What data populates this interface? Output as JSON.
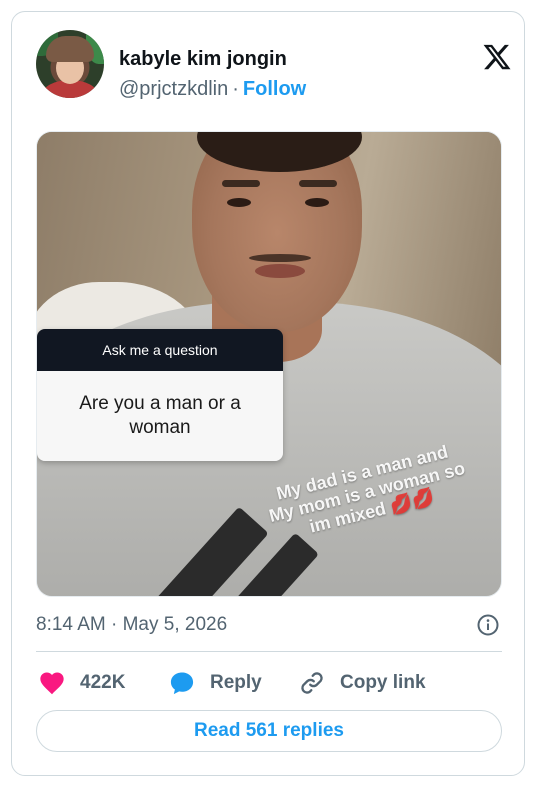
{
  "author": {
    "name": "kabyle kim jongin",
    "handle": "@prjctzkdlin",
    "separator": "·",
    "follow_label": "Follow"
  },
  "media": {
    "question_header": "Ask me a question",
    "question_text": "Are you a man or a woman",
    "overlay_lines": [
      "My dad is a man and",
      "My mom is a woman so",
      "im mixed 💋💋"
    ]
  },
  "meta": {
    "time": "8:14 AM",
    "separator": "·",
    "date": "May 5, 2026"
  },
  "actions": {
    "likes": "422K",
    "reply_label": "Reply",
    "copy_label": "Copy link"
  },
  "read_replies_label": "Read 561 replies",
  "colors": {
    "accent": "#1d9bf0",
    "like": "#f91880",
    "muted": "#536471",
    "border": "#cfd9de"
  },
  "icons": [
    "x-logo-icon",
    "info-icon",
    "heart-icon",
    "reply-bubble-icon",
    "link-icon"
  ]
}
